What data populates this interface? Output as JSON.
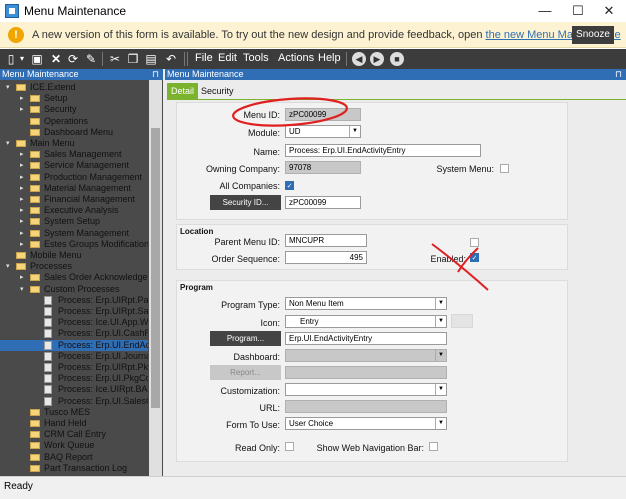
{
  "window": {
    "title": "Menu Maintenance",
    "minimize": "—",
    "maximize": "☐",
    "close": "✕"
  },
  "banner": {
    "prefix": "A new version of this form is available. To try out the new design and provide feedback, open ",
    "link": "the new Menu Maintenance",
    "snooze": "Snooze"
  },
  "toolbar": {
    "menus": [
      "File",
      "Edit",
      "Tools",
      "Actions",
      "Help"
    ]
  },
  "tree": {
    "header": "Menu Maintenance",
    "pin": "⊓",
    "items": [
      {
        "label": "ICE.Extend",
        "indent": 0,
        "kind": "folder",
        "arrow": "▾"
      },
      {
        "label": "Setup",
        "indent": 1,
        "kind": "folder",
        "arrow": "▸"
      },
      {
        "label": "Security",
        "indent": 1,
        "kind": "folder",
        "arrow": "▸"
      },
      {
        "label": "Operations",
        "indent": 1,
        "kind": "folder",
        "arrow": ""
      },
      {
        "label": "Dashboard Menu",
        "indent": 1,
        "kind": "folder",
        "arrow": ""
      },
      {
        "label": "Main Menu",
        "indent": 0,
        "kind": "folder",
        "arrow": "▾"
      },
      {
        "label": "Sales Management",
        "indent": 1,
        "kind": "folder",
        "arrow": "▸"
      },
      {
        "label": "Service Management",
        "indent": 1,
        "kind": "folder",
        "arrow": "▸"
      },
      {
        "label": "Production Management",
        "indent": 1,
        "kind": "folder",
        "arrow": "▸"
      },
      {
        "label": "Material Management",
        "indent": 1,
        "kind": "folder",
        "arrow": "▸"
      },
      {
        "label": "Financial Management",
        "indent": 1,
        "kind": "folder",
        "arrow": "▸"
      },
      {
        "label": "Executive Analysis",
        "indent": 1,
        "kind": "folder",
        "arrow": "▸"
      },
      {
        "label": "System Setup",
        "indent": 1,
        "kind": "folder",
        "arrow": "▸"
      },
      {
        "label": "System Management",
        "indent": 1,
        "kind": "folder",
        "arrow": "▸"
      },
      {
        "label": "Estes Groups Modifications",
        "indent": 1,
        "kind": "folder",
        "arrow": "▸"
      },
      {
        "label": "Mobile Menu",
        "indent": 0,
        "kind": "folder",
        "arrow": ""
      },
      {
        "label": "Processes",
        "indent": 0,
        "kind": "folder",
        "arrow": "▾"
      },
      {
        "label": "Sales Order Acknowledgeme",
        "indent": 1,
        "kind": "folder",
        "arrow": "▸"
      },
      {
        "label": "Custom Processes",
        "indent": 1,
        "kind": "folder",
        "arrow": "▾"
      },
      {
        "label": "Process: Erp.UIRpt.Packi",
        "indent": 2,
        "kind": "doc",
        "arrow": ""
      },
      {
        "label": "Process: Erp.UIRpt.Sales",
        "indent": 2,
        "kind": "doc",
        "arrow": ""
      },
      {
        "label": "Process: Ice.UI.App.Wher",
        "indent": 2,
        "kind": "doc",
        "arrow": ""
      },
      {
        "label": "Process: Erp.UI.CashRec",
        "indent": 2,
        "kind": "doc",
        "arrow": ""
      },
      {
        "label": "Process: Erp.UI.EndActivi",
        "indent": 2,
        "kind": "doc",
        "arrow": "",
        "selected": true
      },
      {
        "label": "Process: Erp.UI.JournalTr",
        "indent": 2,
        "kind": "doc",
        "arrow": ""
      },
      {
        "label": "Process: Erp.UIRpt.PkgC",
        "indent": 2,
        "kind": "doc",
        "arrow": ""
      },
      {
        "label": "Process: Erp.UI.PkgContr",
        "indent": 2,
        "kind": "doc",
        "arrow": ""
      },
      {
        "label": "Process: Ice.UIRpt.BAQR",
        "indent": 2,
        "kind": "doc",
        "arrow": ""
      },
      {
        "label": "Process: Erp.UI.SalesOrd",
        "indent": 2,
        "kind": "doc",
        "arrow": ""
      },
      {
        "label": "Tusco MES",
        "indent": 1,
        "kind": "folder",
        "arrow": ""
      },
      {
        "label": "Hand Held",
        "indent": 1,
        "kind": "folder",
        "arrow": ""
      },
      {
        "label": "CRM Call Entry",
        "indent": 1,
        "kind": "folder",
        "arrow": ""
      },
      {
        "label": "Work Queue",
        "indent": 1,
        "kind": "folder",
        "arrow": ""
      },
      {
        "label": "BAQ Report",
        "indent": 1,
        "kind": "folder",
        "arrow": ""
      },
      {
        "label": "Part Transaction Log",
        "indent": 1,
        "kind": "folder",
        "arrow": ""
      }
    ]
  },
  "detail": {
    "header": "Menu Maintenance",
    "pin": "⊓",
    "tabs": [
      "Detail",
      "Security"
    ],
    "menu_id_label": "Menu ID:",
    "menu_id": "zPC00099",
    "module_label": "Module:",
    "module": "UD",
    "name_label": "Name:",
    "name": "Process: Erp.UI.EndActivityEntry",
    "owning_label": "Owning Company:",
    "owning": "97078",
    "system_menu_label": "System Menu:",
    "all_companies_label": "All Companies:",
    "security_id_button": "Security ID...",
    "security_id": "zPC00099",
    "location_title": "Location",
    "parent_label": "Parent Menu ID:",
    "parent": "MNCUPR",
    "order_label": "Order Sequence:",
    "order": "495",
    "enabled_label": "Enabled:",
    "program_title": "Program",
    "program_type_label": "Program Type:",
    "program_type": "Non Menu Item",
    "icon_label": "Icon:",
    "icon_value": "Entry",
    "program_button": "Program...",
    "program": "Erp.UI.EndActivityEntry",
    "dashboard_label": "Dashboard:",
    "report_button": "Report...",
    "customization_label": "Customization:",
    "url_label": "URL:",
    "form_label": "Form To Use:",
    "form": "User Choice",
    "readonly_label": "Read Only:",
    "webnav_label": "Show Web Navigation Bar:"
  },
  "status": {
    "text": "Ready"
  },
  "colors": {
    "accent": "#2f6db4",
    "annotation": "#e02020",
    "tab_green": "#7bb32e"
  }
}
